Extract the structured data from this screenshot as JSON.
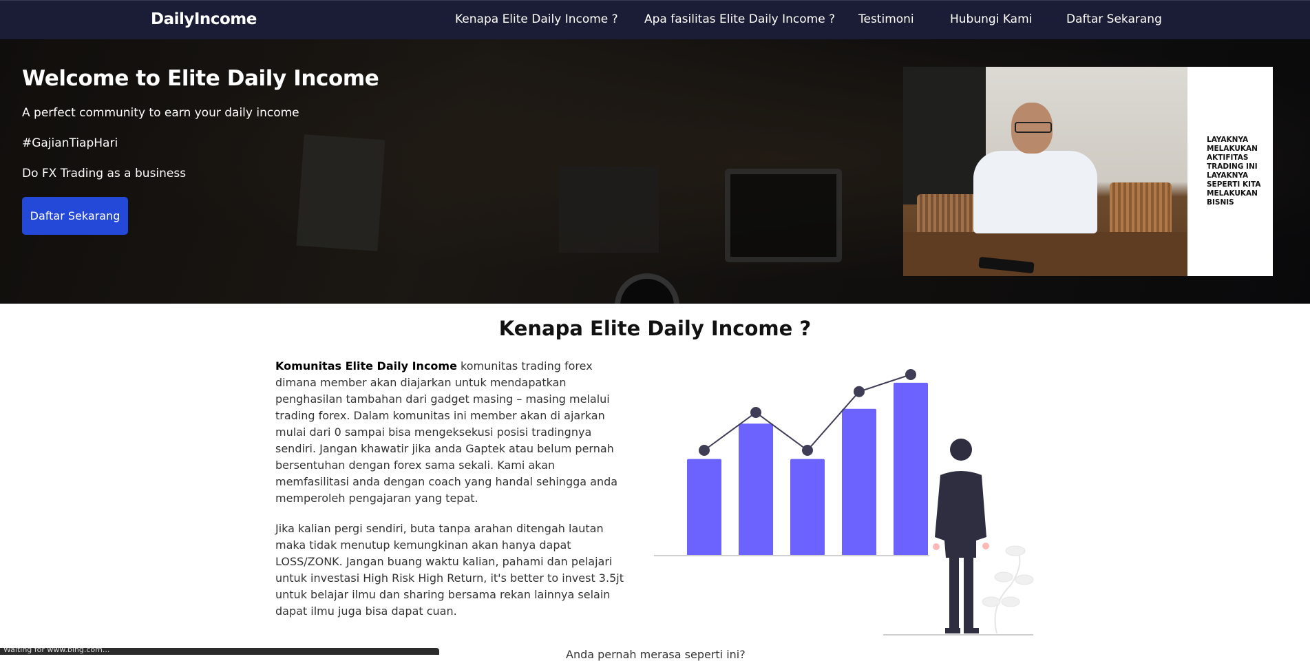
{
  "nav": {
    "logo": "DailyIncome",
    "links": [
      "Kenapa Elite Daily Income ?",
      "Apa fasilitas Elite Daily Income ?",
      "Testimoni",
      "Hubungi Kami",
      "Daftar Sekarang"
    ]
  },
  "hero": {
    "title": "Welcome to Elite Daily Income",
    "subtitle": "A perfect community to earn your daily income",
    "hashtag": "#GajianTiapHari",
    "tagline": "Do FX Trading as a business",
    "cta_label": "Daftar Sekarang",
    "video_caption": "LAYAKNYA MELAKUKAN AKTIFITAS TRADING INI LAYAKNYA SEPERTI KITA MELAKUKAN BISNIS"
  },
  "section": {
    "title": "Kenapa Elite Daily Income ?",
    "p1_bold": "Komunitas Elite Daily Income",
    "p1_rest": " komunitas trading forex dimana member akan diajarkan untuk mendapatkan penghasilan tambahan dari gadget masing – masing melalui trading forex. Dalam komunitas ini member akan di ajarkan mulai dari 0 sampai bisa mengeksekusi posisi tradingnya sendiri. Jangan khawatir jika anda Gaptek atau belum pernah bersentuhan dengan forex sama sekali. Kami akan memfasilitasi anda dengan coach yang handal sehingga anda memperoleh pengajaran yang tepat.",
    "p2": "Jika kalian pergi sendiri, buta tanpa arahan ditengah lautan maka tidak menutup kemungkinan akan hanya dapat LOSS/ZONK. Jangan buang waktu kalian, pahami dan pelajari untuk investasi High Risk High Return, it's better to invest 3.5jt untuk belajar ilmu dan sharing bersama rekan lainnya selain dapat ilmu juga bisa dapat cuan.",
    "next_heading": "Anda pernah merasa seperti ini?"
  },
  "illustration": {
    "bars": [
      0.52,
      0.71,
      0.52,
      0.79,
      0.93
    ],
    "points": [
      0.6,
      0.8,
      0.6,
      0.91,
      1.0
    ],
    "bar_color": "#6c63ff",
    "dot_color": "#3f3d56"
  },
  "status": {
    "text": "Waiting for www.bing.com..."
  },
  "colors": {
    "nav_bg": "#1b1c35",
    "cta_bg": "#2449d8"
  }
}
